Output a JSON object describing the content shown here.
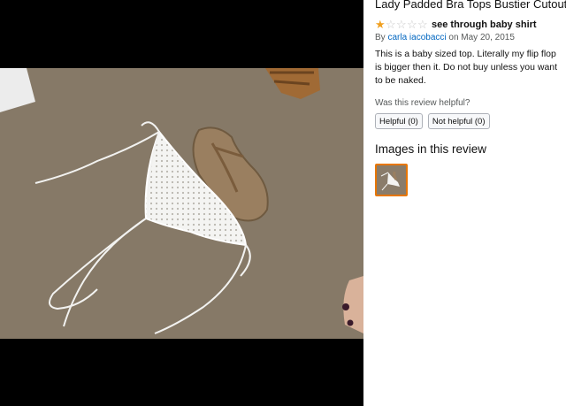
{
  "review_panel": {
    "product_title": "Lady Padded Bra Tops Bustier Cutout Vest Crop Top Bralette Tank Blouse (One Size,",
    "rating": {
      "value": 1,
      "max": 5,
      "filled_star": "★",
      "empty_star": "☆"
    },
    "review_title": "see through baby shirt",
    "byline_prefix": "By",
    "author": "carla iacobacci",
    "date_text": "on May 20, 2015",
    "body": "This is a baby sized top. Literally my flip flop is bigger then it. Do not buy unless you want to be naked.",
    "helpful_question": "Was this review helpful?",
    "helpful_button": "Helpful (0)",
    "not_helpful_button": "Not helpful (0)",
    "images_heading": "Images in this review"
  },
  "colors": {
    "carpet": "#8a7c6a",
    "star_filled": "#f0a020",
    "link": "#0066c0",
    "thumb_border": "#e77600"
  },
  "icons": [
    "star-icon"
  ]
}
